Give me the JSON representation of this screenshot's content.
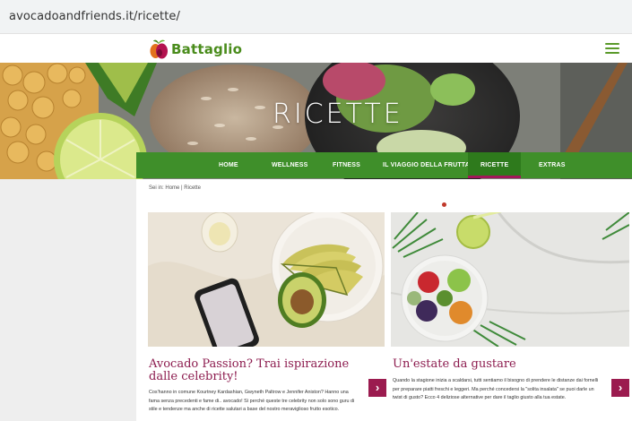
{
  "browser": {
    "url": "avocadoandfriends.it/ricette/"
  },
  "header": {
    "logo_text": "Battaglio",
    "menu_icon": "hamburger-menu-icon"
  },
  "hero": {
    "title": "RICETTE"
  },
  "nav": {
    "items": [
      {
        "label": "HOME"
      },
      {
        "label": "WELLNESS"
      },
      {
        "label": "FITNESS"
      },
      {
        "label": "IL VIAGGIO DELLA FRUTTA"
      },
      {
        "label": "RICETTE",
        "active": true
      },
      {
        "label": "EXTRAS"
      }
    ]
  },
  "breadcrumb": {
    "prefix": "Sei in:",
    "home": "Home",
    "separator": "|",
    "current": "Ricette"
  },
  "cards": [
    {
      "title": "Avocado Passion? Trai ispirazione dalle celebrity!",
      "excerpt": "Cos'hanno in comune Kourtney Kardashian, Gwyneth Paltrow e Jennifer Aniston? Hanno una fama senza precedenti e fame di.. avocado! Sì perché queste tre celebrity non solo sono guru di stile e tendenze ma anche di ricette salutari a base del nostro meraviglioso frutto esotico.",
      "arrow": "chevron-right-icon"
    },
    {
      "title": "Un'estate da gustare",
      "excerpt": "Quando la stagione inizia a scaldarsi, tutti sentiamo il bisogno di prendere le distanze dai fornelli per preparare piatti freschi e leggeri. Ma perché concedersi la \"solita insalata\" se puoi darle un twist di gusto? Ecco 4 deliziose alternative per dare il taglio giusto alla tua estate.",
      "arrow": "chevron-right-icon"
    }
  ],
  "colors": {
    "nav_green": "#3f8f2a",
    "active_accent": "#a3165a",
    "title_magenta": "#8c1b4e",
    "arrow_bg": "#9b1b4f",
    "logo_green": "#4a8c1c"
  }
}
